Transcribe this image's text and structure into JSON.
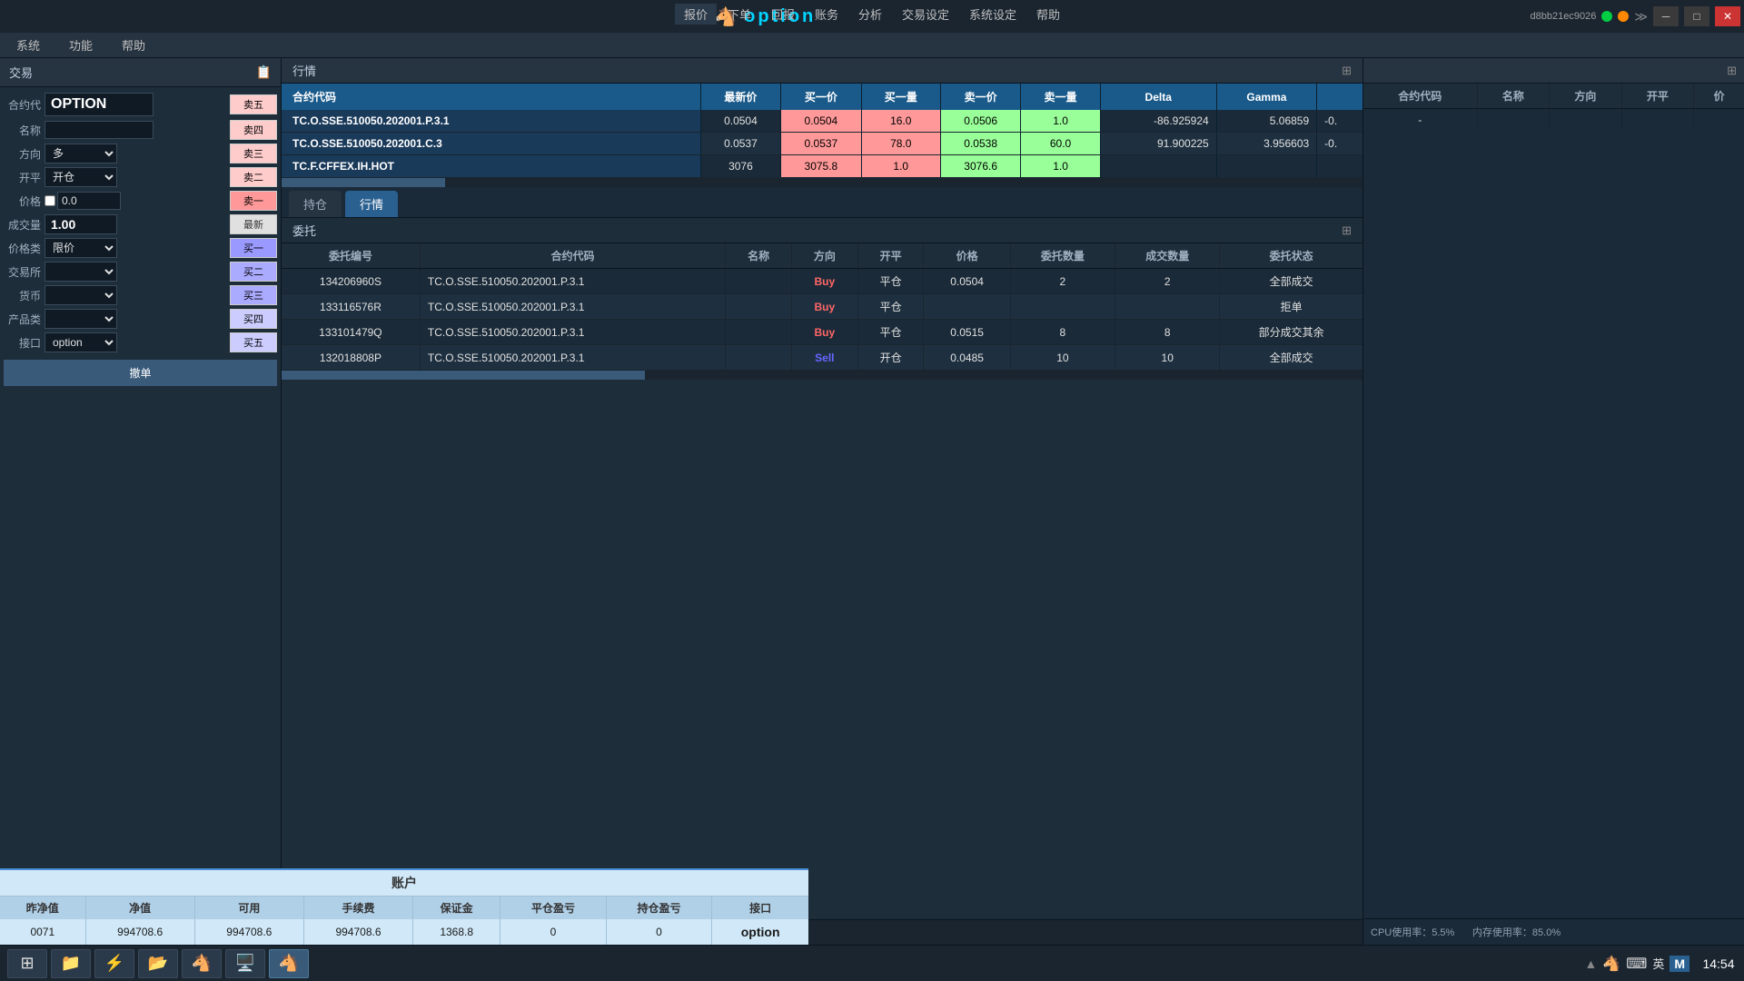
{
  "titleBar": {
    "logo": "🐴",
    "appName": "option",
    "menus": [
      "报价",
      "下单",
      "回报",
      "账务",
      "分析",
      "交易设定",
      "系统设定",
      "帮助"
    ],
    "accountId": "d8bb21ec9026",
    "closeBtn": "✕",
    "minBtn": "─",
    "maxBtn": "□"
  },
  "menuBar": {
    "items": [
      "系统",
      "功能",
      "帮助"
    ]
  },
  "leftPanel": {
    "title": "交易",
    "symbol": "OPTION",
    "fields": {
      "合约代": "合约代",
      "名称": "名称",
      "方向": "方向",
      "direction_val": "多",
      "开平": "开平",
      "openclose_val": "开仓",
      "价格": "价格",
      "price_val": "0.0",
      "成交量": "成交量",
      "qty_val": "1.00",
      "价格类": "价格类",
      "pricetype_val": "限价",
      "交易所": "交易所",
      "货币": "货币",
      "产品类": "产品类",
      "接口": "接口",
      "interface_val": "option"
    },
    "sellLabels": [
      "卖五",
      "卖四",
      "卖三",
      "卖二",
      "卖一",
      "最新",
      "买一",
      "买二",
      "买三",
      "买四",
      "买五"
    ],
    "bottomBtn": "撤单"
  },
  "marketSection": {
    "title": "行情",
    "columns": [
      "合约代码",
      "最新价",
      "买一价",
      "买一量",
      "卖一价",
      "卖一量",
      "Delta",
      "Gamma"
    ],
    "rows": [
      {
        "code": "TC.O.SSE.510050.202001.P.3.1",
        "lastPrice": "0.0504",
        "buyPrice": "0.0504",
        "buyQty": "16.0",
        "sellPrice": "0.0506",
        "sellQty": "1.0",
        "delta": "-86.925924",
        "gamma": "5.06859",
        "extraDelta": "-0."
      },
      {
        "code": "TC.O.SSE.510050.202001.C.3",
        "lastPrice": "0.0537",
        "buyPrice": "0.0537",
        "buyQty": "78.0",
        "sellPrice": "0.0538",
        "sellQty": "60.0",
        "delta": "91.900225",
        "gamma": "3.956603",
        "extraDelta": "-0."
      },
      {
        "code": "TC.F.CFFEX.IH.HOT",
        "lastPrice": "3076",
        "buyPrice": "3075.8",
        "buyQty": "1.0",
        "sellPrice": "3076.6",
        "sellQty": "1.0",
        "delta": "",
        "gamma": "",
        "extraDelta": ""
      }
    ]
  },
  "tabs": {
    "items": [
      "持仓",
      "行情"
    ],
    "active": "行情"
  },
  "orderSection": {
    "title": "委托",
    "columns": [
      "委托编号",
      "合约代码",
      "名称",
      "方向",
      "开平",
      "价格",
      "委托数量",
      "成交数量",
      "委托状态"
    ],
    "rows": [
      {
        "id": "134206960S",
        "code": "TC.O.SSE.510050.202001.P.3.1",
        "name": "",
        "direction": "Buy",
        "openclose": "平仓",
        "price": "0.0504",
        "orderQty": "2",
        "tradeQty": "2",
        "status": "全部成交"
      },
      {
        "id": "133116576R",
        "code": "TC.O.SSE.510050.202001.P.3.1",
        "name": "",
        "direction": "Buy",
        "openclose": "平仓",
        "price": "",
        "orderQty": "",
        "tradeQty": "",
        "status": "拒单"
      },
      {
        "id": "133101479Q",
        "code": "TC.O.SSE.510050.202001.P.3.1",
        "name": "",
        "direction": "Buy",
        "openclose": "平仓",
        "price": "0.0515",
        "orderQty": "8",
        "tradeQty": "8",
        "status": "部分成交其余"
      },
      {
        "id": "132018808P",
        "code": "TC.O.SSE.510050.202001.P.3.1",
        "name": "",
        "direction": "Sell",
        "openclose": "开仓",
        "price": "0.0485",
        "orderQty": "10",
        "tradeQty": "10",
        "status": "全部成交"
      }
    ]
  },
  "accountBar": {
    "title": "账户",
    "columns": [
      "昨净值",
      "净值",
      "可用",
      "手续费",
      "保证金",
      "平仓盈亏",
      "持仓盈亏",
      "接口"
    ],
    "row": {
      "昨净值": "0071",
      "净值": "994708.6",
      "可用": "994708.6",
      "手续费": "994708.6",
      "保证金": "1368.8",
      "平仓盈亏": "0",
      "持仓盈亏": "0",
      "接口": "option"
    }
  },
  "rightBottomPanel": {
    "columns": [
      "合约代码",
      "名称",
      "方向",
      "开平",
      "价"
    ],
    "dashRow": [
      "-",
      "",
      "",
      "",
      ""
    ]
  },
  "sysInfo": {
    "cpu": "CPU使用率：5.5%",
    "memory": "内存使用率：85.0%"
  },
  "taskbar": {
    "time": "14:54",
    "icons": [
      "⊞",
      "📁",
      "⚡",
      "📂",
      "🐴",
      "🎮",
      "🐴"
    ],
    "lang": "英",
    "ime": "M"
  }
}
